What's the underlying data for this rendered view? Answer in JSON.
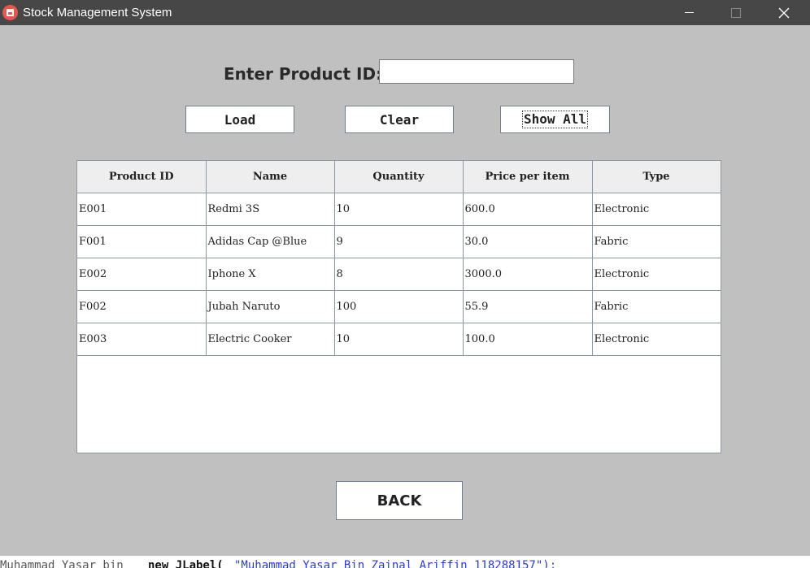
{
  "window": {
    "title": "Stock Management System"
  },
  "form": {
    "prompt_label": "Enter Product ID:",
    "product_id_value": "",
    "buttons": {
      "load": "Load",
      "clear": "Clear",
      "show_all": "Show All",
      "back": "BACK"
    }
  },
  "table": {
    "columns": [
      "Product ID",
      "Name",
      "Quantity",
      "Price per item",
      "Type"
    ],
    "rows": [
      [
        "E001",
        "Redmi 3S",
        "10",
        "600.0",
        "Electronic"
      ],
      [
        "F001",
        "Adidas Cap @Blue",
        "9",
        "30.0",
        "Fabric"
      ],
      [
        "E002",
        "Iphone X",
        "8",
        "3000.0",
        "Electronic"
      ],
      [
        "F002",
        "Jubah Naruto",
        "100",
        "55.9",
        "Fabric"
      ],
      [
        "E003",
        "Electric Cooker",
        "10",
        "100.0",
        "Electronic"
      ]
    ]
  },
  "background_text": {
    "left": "Muhammad Yasar bin",
    "middle": "new JLabel(",
    "right": "\"Muhammad Yasar Bin Zainal Ariffin 118288157\");"
  },
  "colors": {
    "titlebar": "#474747",
    "window_bg": "#c0c0c0",
    "app_icon": "#e9564b",
    "table_header_bg": "#eeeeee",
    "grid_line": "#8a99a8"
  },
  "icons": {
    "app": "stock-app-icon",
    "minimize": "minimize-icon",
    "maximize": "maximize-icon",
    "close": "close-icon"
  }
}
